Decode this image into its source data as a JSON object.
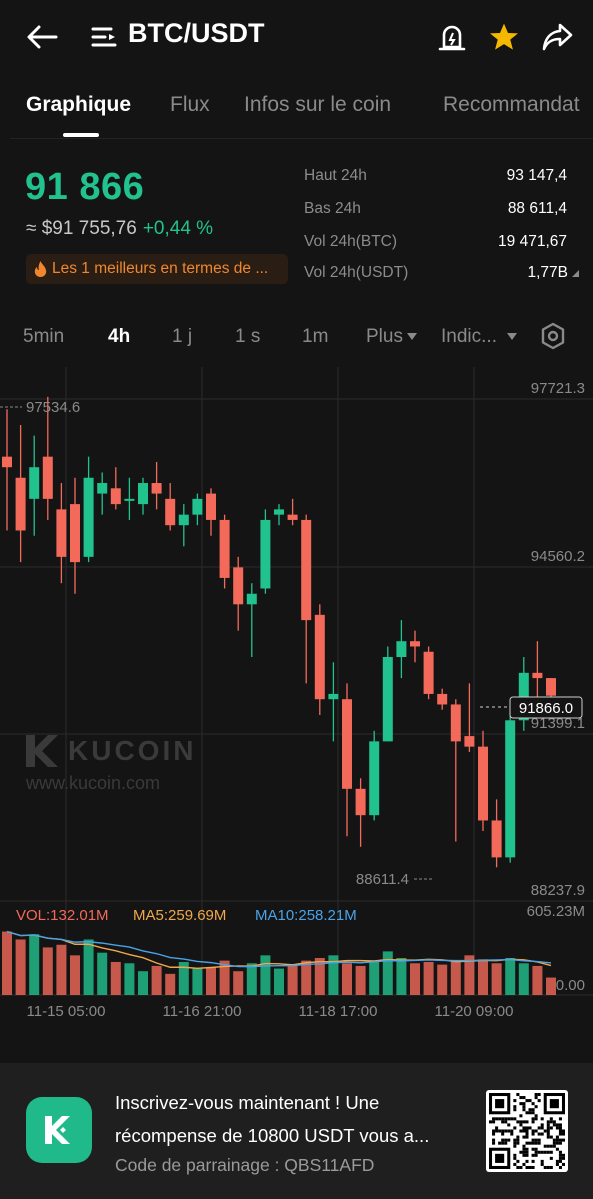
{
  "header": {
    "title": "BTC/USDT",
    "icons": [
      "back-arrow-icon",
      "menu-icon",
      "price-alert-icon",
      "star-icon",
      "share-icon"
    ],
    "star_color": "#f5b800"
  },
  "tabs": [
    {
      "label": "Graphique",
      "active": true
    },
    {
      "label": "Flux",
      "active": false
    },
    {
      "label": "Infos sur le coin",
      "active": false
    },
    {
      "label": "Recommandat",
      "active": false
    }
  ],
  "ticker": {
    "price": "91 866",
    "usd_equiv": "≈ $91 755,76",
    "change": "+0,44 %",
    "rank_badge": "Les 1 meilleurs en termes de ...",
    "up_color": "#21c28e",
    "down_color": "#f46a5a",
    "stats": [
      {
        "label": "Haut 24h",
        "value": "93 147,4"
      },
      {
        "label": "Bas 24h",
        "value": "88 611,4"
      },
      {
        "label": "Vol 24h(BTC)",
        "value": "19 471,67"
      },
      {
        "label": "Vol 24h(USDT)",
        "value": "1,77B"
      }
    ]
  },
  "intervals": [
    {
      "label": "5min",
      "active": false
    },
    {
      "label": "4h",
      "active": true
    },
    {
      "label": "1 j",
      "active": false
    },
    {
      "label": "1 s",
      "active": false
    },
    {
      "label": "1m",
      "active": false
    },
    {
      "label": "Plus",
      "active": false
    },
    {
      "label": "Indic...",
      "active": false
    }
  ],
  "chart_data": {
    "type": "candlestick",
    "y_ticks": [
      "97721.3",
      "94560.2",
      "91399.1",
      "88237.9"
    ],
    "ylim": [
      88237.9,
      97721.3
    ],
    "last_price_label": "91866.0",
    "last_price": 91866.0,
    "high_marker": "97534.6",
    "low_marker": "88611.4",
    "x_ticks": [
      "11-15 05:00",
      "11-16 21:00",
      "11-18 17:00",
      "11-20 09:00"
    ],
    "watermark": {
      "brand": "KUCOIN",
      "url": "www.kucoin.com"
    },
    "candles": [
      {
        "o": 96400,
        "h": 97300,
        "l": 95000,
        "c": 96200
      },
      {
        "o": 96000,
        "h": 97000,
        "l": 94400,
        "c": 95000
      },
      {
        "o": 95600,
        "h": 96800,
        "l": 94900,
        "c": 96200
      },
      {
        "o": 96400,
        "h": 97534.6,
        "l": 95200,
        "c": 95600
      },
      {
        "o": 95400,
        "h": 95900,
        "l": 94000,
        "c": 94500
      },
      {
        "o": 95500,
        "h": 96000,
        "l": 93800,
        "c": 94400
      },
      {
        "o": 94500,
        "h": 96400,
        "l": 94400,
        "c": 96000
      },
      {
        "o": 95700,
        "h": 96100,
        "l": 95300,
        "c": 95900
      },
      {
        "o": 95800,
        "h": 96200,
        "l": 95400,
        "c": 95500
      },
      {
        "o": 95600,
        "h": 96000,
        "l": 95200,
        "c": 95600
      },
      {
        "o": 95500,
        "h": 96000,
        "l": 95300,
        "c": 95900
      },
      {
        "o": 95900,
        "h": 96300,
        "l": 95400,
        "c": 95700
      },
      {
        "o": 95600,
        "h": 95900,
        "l": 95000,
        "c": 95100
      },
      {
        "o": 95100,
        "h": 95500,
        "l": 94700,
        "c": 95300
      },
      {
        "o": 95300,
        "h": 95700,
        "l": 95100,
        "c": 95600
      },
      {
        "o": 95700,
        "h": 95800,
        "l": 94900,
        "c": 95200
      },
      {
        "o": 95200,
        "h": 95300,
        "l": 93900,
        "c": 94100
      },
      {
        "o": 94300,
        "h": 94500,
        "l": 93100,
        "c": 93600
      },
      {
        "o": 93600,
        "h": 94000,
        "l": 92600,
        "c": 93800
      },
      {
        "o": 93900,
        "h": 95400,
        "l": 93800,
        "c": 95200
      },
      {
        "o": 95300,
        "h": 95500,
        "l": 95100,
        "c": 95400
      },
      {
        "o": 95300,
        "h": 95600,
        "l": 95100,
        "c": 95200
      },
      {
        "o": 95200,
        "h": 95300,
        "l": 92100,
        "c": 93300
      },
      {
        "o": 93400,
        "h": 93600,
        "l": 91500,
        "c": 91800
      },
      {
        "o": 91800,
        "h": 92500,
        "l": 91000,
        "c": 91900
      },
      {
        "o": 91800,
        "h": 92100,
        "l": 89200,
        "c": 90100
      },
      {
        "o": 90100,
        "h": 90300,
        "l": 89000,
        "c": 89600
      },
      {
        "o": 89600,
        "h": 91200,
        "l": 89500,
        "c": 91000
      },
      {
        "o": 91000,
        "h": 92800,
        "l": 91000,
        "c": 92600
      },
      {
        "o": 92600,
        "h": 93300,
        "l": 92200,
        "c": 92900
      },
      {
        "o": 92900,
        "h": 93100,
        "l": 92500,
        "c": 92800
      },
      {
        "o": 92700,
        "h": 92800,
        "l": 91800,
        "c": 91900
      },
      {
        "o": 91900,
        "h": 92000,
        "l": 91600,
        "c": 91700
      },
      {
        "o": 91700,
        "h": 91800,
        "l": 89100,
        "c": 91000
      },
      {
        "o": 91100,
        "h": 92100,
        "l": 90800,
        "c": 90900
      },
      {
        "o": 90900,
        "h": 91200,
        "l": 89300,
        "c": 89500
      },
      {
        "o": 89500,
        "h": 89900,
        "l": 88611.4,
        "c": 88800
      },
      {
        "o": 88800,
        "h": 91500,
        "l": 88700,
        "c": 91400
      },
      {
        "o": 91400,
        "h": 92600,
        "l": 91200,
        "c": 92300
      },
      {
        "o": 92300,
        "h": 92900,
        "l": 91500,
        "c": 92200
      },
      {
        "o": 92200,
        "h": 92200,
        "l": 91500,
        "c": 91866
      }
    ],
    "volume": {
      "labels": [
        "VOL:132.01M",
        "MA5:259.69M",
        "MA10:258.21M"
      ],
      "label_colors": [
        "#f46a5a",
        "#f0a84a",
        "#4aa3e8"
      ],
      "ylim_label": "605.23M",
      "zero_label": "0.00",
      "max": 605.23,
      "values": [
        480,
        420,
        460,
        360,
        380,
        300,
        420,
        320,
        250,
        240,
        180,
        220,
        160,
        250,
        200,
        210,
        260,
        180,
        240,
        300,
        200,
        220,
        260,
        280,
        300,
        240,
        220,
        250,
        330,
        280,
        240,
        250,
        230,
        260,
        300,
        270,
        240,
        280,
        240,
        220,
        132.01
      ]
    }
  },
  "banner": {
    "line1": "Inscrivez-vous maintenant ! Une",
    "line2": "récompense de 10800 USDT vous a...",
    "line3": "Code de parrainage : QBS11AFD"
  }
}
